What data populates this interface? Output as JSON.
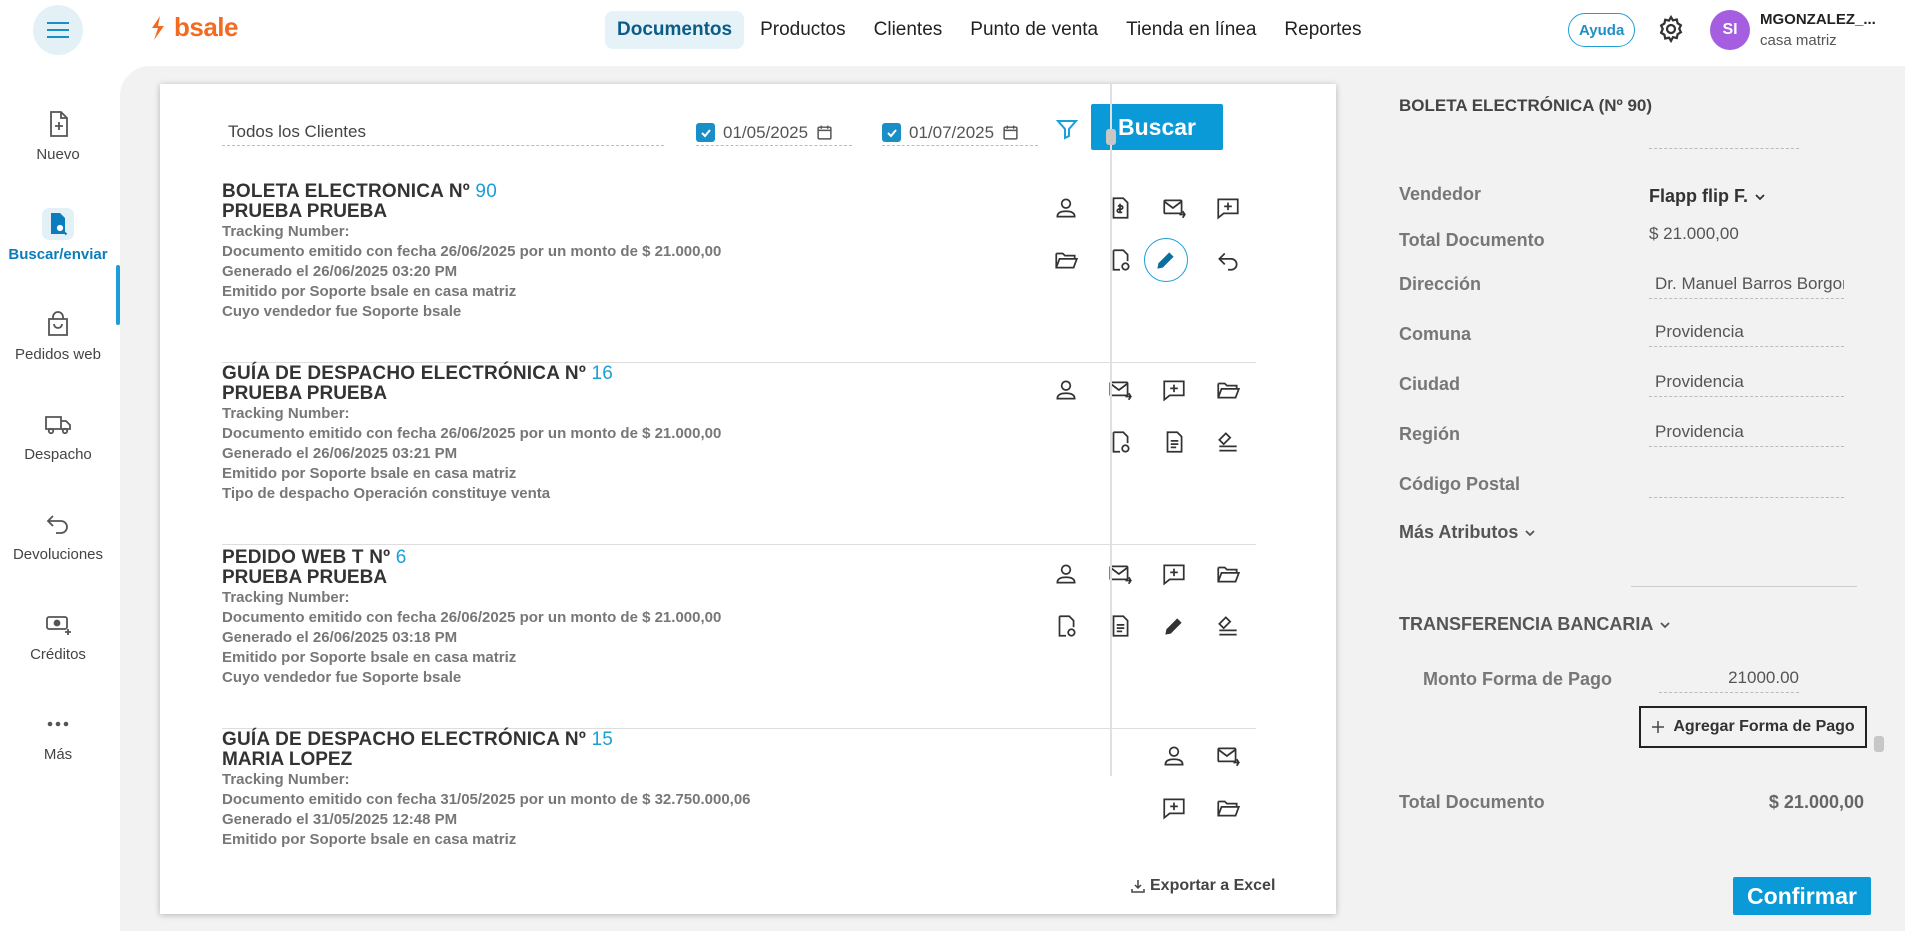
{
  "header": {
    "logo_text": "bsale",
    "nav": [
      "Documentos",
      "Productos",
      "Clientes",
      "Punto de venta",
      "Tienda en línea",
      "Reportes"
    ],
    "active_nav": "Documentos",
    "help_label": "Ayuda",
    "user_initials": "SI",
    "user_name": "MGONZALEZ_...",
    "user_branch": "casa matriz"
  },
  "sidebar": {
    "items": [
      {
        "label": "Nuevo",
        "icon": "new-document-icon"
      },
      {
        "label": "Buscar/enviar",
        "icon": "search-document-icon",
        "active": true
      },
      {
        "label": "Pedidos web",
        "icon": "shopping-bag-icon"
      },
      {
        "label": "Despacho",
        "icon": "truck-icon"
      },
      {
        "label": "Devoluciones",
        "icon": "return-icon"
      },
      {
        "label": "Créditos",
        "icon": "money-plus-icon"
      },
      {
        "label": "Más",
        "icon": "more-dots-icon"
      }
    ]
  },
  "filters": {
    "client": "Todos los Clientes",
    "date_from": "01/05/2025",
    "date_to": "01/07/2025",
    "search_label": "Buscar"
  },
  "documents": [
    {
      "title": "BOLETA ELECTRÓNICA Nº",
      "number": "90",
      "client": "PRUEBA PRUEBA",
      "lines": [
        "Tracking Number:",
        "Documento emitido con fecha 26/06/2025 por un monto de $ 21.000,00",
        "Generado el 26/06/2025 03:20 PM",
        "Emitido por Soporte bsale en casa matriz",
        "Cuyo vendedor fue Soporte bsale"
      ]
    },
    {
      "title": "GUÍA DE DESPACHO ELECTRÓNICA Nº",
      "number": "16",
      "client": "PRUEBA PRUEBA",
      "lines": [
        "Tracking Number:",
        "Documento emitido con fecha 26/06/2025 por un monto de $ 21.000,00",
        "Generado el 26/06/2025 03:21 PM",
        "Emitido por Soporte bsale en casa matriz",
        "Tipo de despacho Operación constituye venta"
      ]
    },
    {
      "title": "PEDIDO WEB T Nº",
      "number": "6",
      "client": "PRUEBA PRUEBA",
      "lines": [
        "Tracking Number:",
        "Documento emitido con fecha 26/06/2025 por un monto de $ 21.000,00",
        "Generado el 26/06/2025 03:18 PM",
        "Emitido por Soporte bsale en casa matriz",
        "Cuyo vendedor fue Soporte bsale"
      ]
    },
    {
      "title": "GUÍA DE DESPACHO ELECTRÓNICA Nº",
      "number": "15",
      "client": "MARIA LOPEZ",
      "lines": [
        "Tracking Number:",
        "Documento emitido con fecha 31/05/2025 por un monto de $ 32.750.000,06",
        "Generado el 31/05/2025 12:48 PM",
        "Emitido por Soporte bsale en casa matriz"
      ]
    }
  ],
  "export_label": "Exportar a Excel",
  "detail": {
    "title": "BOLETA ELECTRÓNICA (Nº 90)",
    "vendedor_label": "Vendedor",
    "vendedor_value": "Flapp flip F.",
    "total_doc_label": "Total Documento",
    "total_doc_value": "$ 21.000,00",
    "direccion_label": "Dirección",
    "direccion_value": "Dr. Manuel Barros Borgoño",
    "comuna_label": "Comuna",
    "comuna_value": "Providencia",
    "ciudad_label": "Ciudad",
    "ciudad_value": "Providencia",
    "region_label": "Región",
    "region_value": "Providencia",
    "cp_label": "Código Postal",
    "cp_value": "",
    "more_attrs_label": "Más Atributos",
    "payment_method": "TRANSFERENCIA BANCARIA",
    "monto_label": "Monto Forma de Pago",
    "monto_value": "21000.00",
    "add_payment_label": "Agregar Forma de Pago",
    "total_label": "Total Documento",
    "total_value": "$ 21.000,00",
    "confirm_label": "Confirmar"
  },
  "colors": {
    "brand_orange": "#f36b21",
    "accent_blue": "#0b9ad8",
    "number_blue": "#1a9fd8"
  }
}
